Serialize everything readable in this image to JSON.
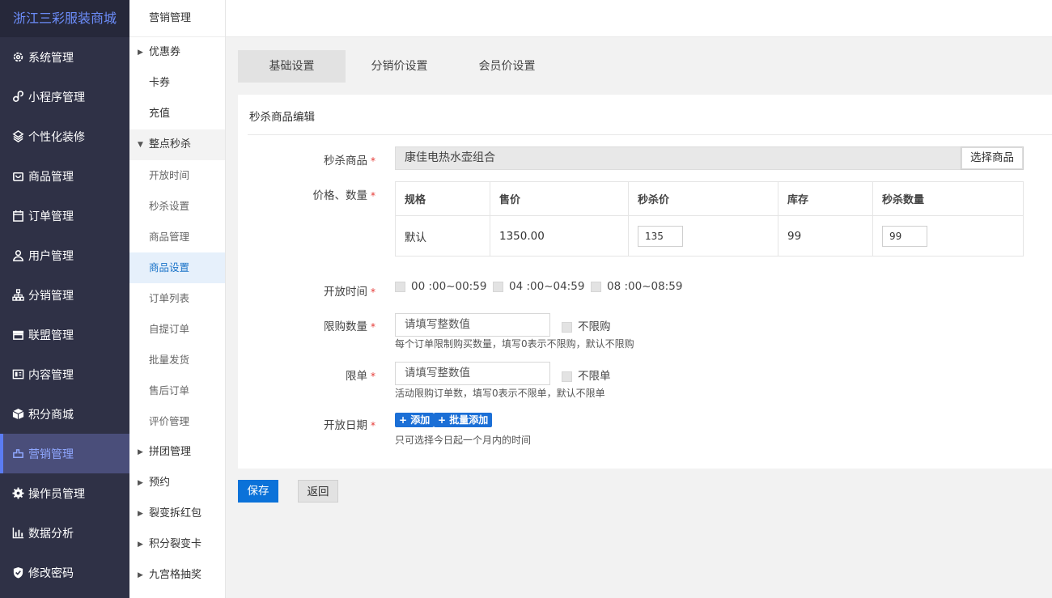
{
  "sidebar": {
    "brand": "浙江三彩服装商城",
    "items": [
      {
        "label": "系统管理",
        "icon": "gear-icon"
      },
      {
        "label": "小程序管理",
        "icon": "link-icon"
      },
      {
        "label": "个性化装修",
        "icon": "layers-icon"
      },
      {
        "label": "商品管理",
        "icon": "bag-icon"
      },
      {
        "label": "订单管理",
        "icon": "calendar-icon"
      },
      {
        "label": "用户管理",
        "icon": "user-icon"
      },
      {
        "label": "分销管理",
        "icon": "hierarchy-icon"
      },
      {
        "label": "联盟管理",
        "icon": "store-icon"
      },
      {
        "label": "内容管理",
        "icon": "content-icon"
      },
      {
        "label": "积分商城",
        "icon": "box-icon"
      },
      {
        "label": "营销管理",
        "icon": "marketing-icon"
      },
      {
        "label": "操作员管理",
        "icon": "cog-icon"
      },
      {
        "label": "数据分析",
        "icon": "chart-icon"
      },
      {
        "label": "修改密码",
        "icon": "shield-icon"
      }
    ]
  },
  "submenu": {
    "title": "营销管理",
    "items": [
      {
        "label": "优惠券"
      },
      {
        "label": "卡券"
      },
      {
        "label": "充值"
      },
      {
        "label": "整点秒杀"
      },
      {
        "label": "开放时间"
      },
      {
        "label": "秒杀设置"
      },
      {
        "label": "商品管理"
      },
      {
        "label": "商品设置"
      },
      {
        "label": "订单列表"
      },
      {
        "label": "自提订单"
      },
      {
        "label": "批量发货"
      },
      {
        "label": "售后订单"
      },
      {
        "label": "评价管理"
      },
      {
        "label": "拼团管理"
      },
      {
        "label": "预约"
      },
      {
        "label": "裂变拆红包"
      },
      {
        "label": "积分裂变卡"
      },
      {
        "label": "九宫格抽奖"
      }
    ]
  },
  "tabs": [
    {
      "label": "基础设置"
    },
    {
      "label": "分销价设置"
    },
    {
      "label": "会员价设置"
    }
  ],
  "form": {
    "section_title": "秒杀商品编辑",
    "required_mark": "*",
    "product": {
      "label": "秒杀商品",
      "value": "康佳电热水壶组合",
      "button": "选择商品"
    },
    "price": {
      "label": "价格、数量",
      "headers": [
        "规格",
        "售价",
        "秒杀价",
        "库存",
        "秒杀数量"
      ],
      "rows": [
        {
          "spec": "默认",
          "price": "1350.00",
          "seckill_price": "135",
          "stock": "99",
          "seckill_qty": "99"
        }
      ]
    },
    "open_time": {
      "label": "开放时间",
      "options": [
        "00 :00~00:59",
        "04 :00~04:59",
        "08 :00~08:59"
      ]
    },
    "limit_qty": {
      "label": "限购数量",
      "placeholder": "请填写整数值",
      "checkbox": "不限购",
      "hint": "每个订单限制购买数量，填写0表示不限购，默认不限购"
    },
    "limit_order": {
      "label": "限单",
      "placeholder": "请填写整数值",
      "checkbox": "不限单",
      "hint": "活动限购订单数，填写0表示不限单，默认不限单"
    },
    "open_date": {
      "label": "开放日期",
      "add": "+ 添加",
      "batch_add": "+ 批量添加",
      "hint": "只可选择今日起一个月内的时间"
    }
  },
  "actions": {
    "save": "保存",
    "back": "返回"
  }
}
